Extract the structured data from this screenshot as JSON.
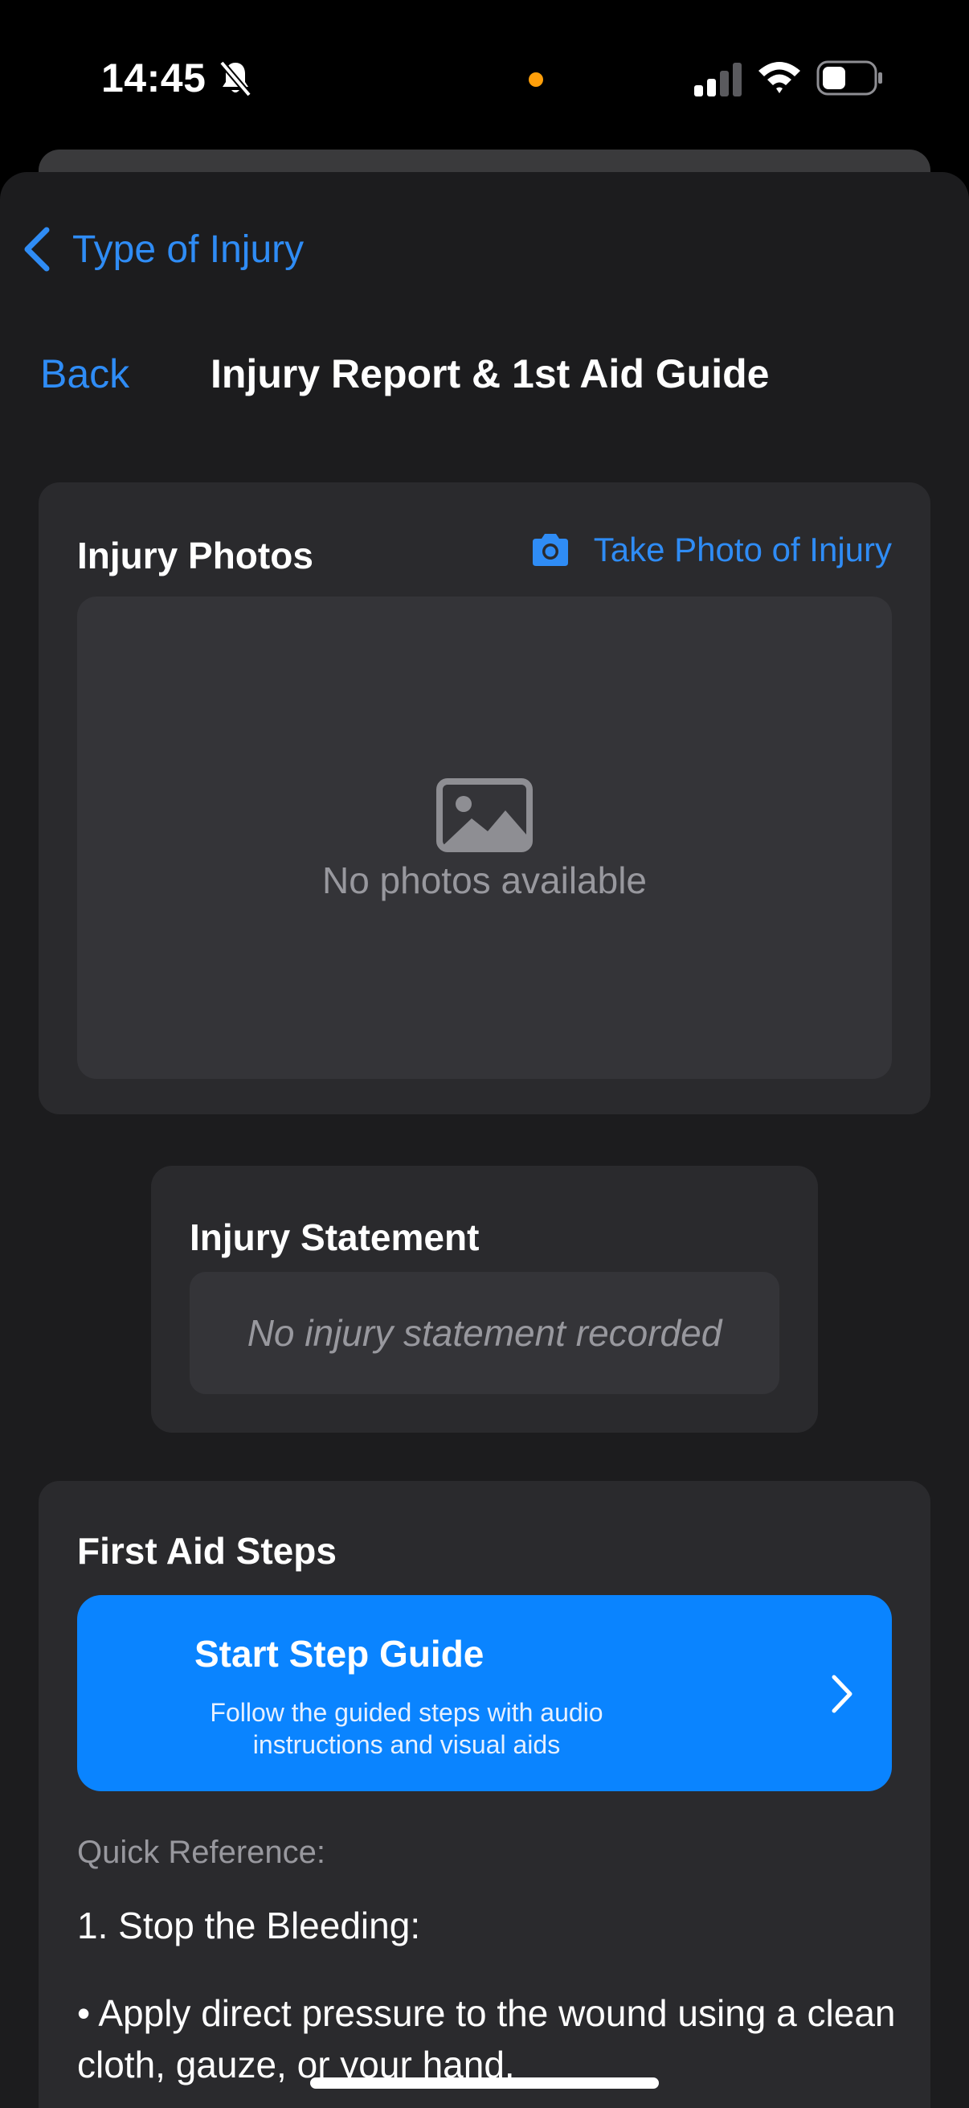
{
  "status": {
    "time": "14:45",
    "colors": {
      "recording_dot": "#ff9f0a"
    }
  },
  "nav": {
    "parent_label": "Type of Injury"
  },
  "header": {
    "back_label": "Back",
    "title": "Injury Report & 1st Aid Guide"
  },
  "photos": {
    "title": "Injury Photos",
    "take_photo_label": "Take Photo of Injury",
    "empty_text": "No photos available"
  },
  "statement": {
    "title": "Injury Statement",
    "empty_text": "No injury statement recorded"
  },
  "first_aid": {
    "title": "First Aid Steps",
    "guide_title": "Start Step Guide",
    "guide_subtitle": "Follow the guided steps with audio instructions and visual aids",
    "quick_reference_label": "Quick Reference:",
    "step_1_heading": "1. Stop the Bleeding:",
    "step_1_bullet": "• Apply direct pressure to the wound using a clean cloth, gauze, or your hand."
  },
  "colors": {
    "accent": "#2f8cf5",
    "button": "#0a84ff",
    "card": "#2a2a2d",
    "sheet": "#1c1c1e"
  }
}
